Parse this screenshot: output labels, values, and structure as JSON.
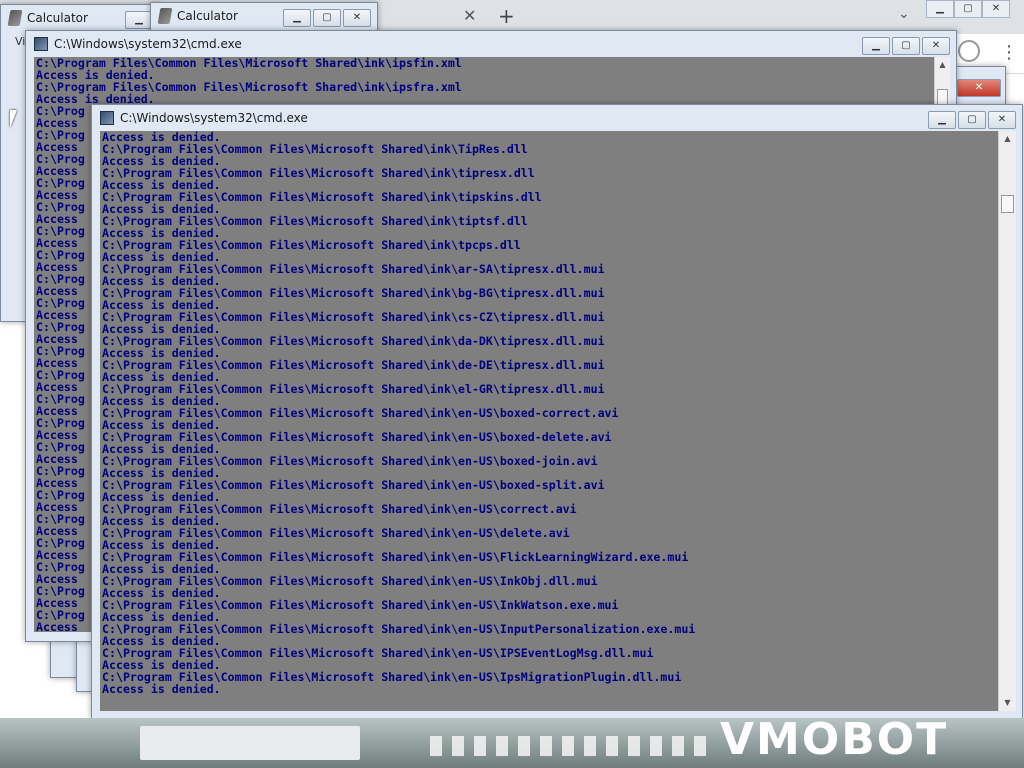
{
  "browser": {
    "close_tab_glyph": "✕",
    "new_tab_glyph": "+",
    "tab_list_glyph": "⌄",
    "menu_glyph": "⋮"
  },
  "calculator_windows": [
    {
      "title": "Calculator"
    },
    {
      "title": "Calculator"
    }
  ],
  "calc_menu_fragment": "Vi",
  "cmd_back": {
    "title": "C:\\Windows\\system32\\cmd.exe",
    "lines": "C:\\Program Files\\Common Files\\Microsoft Shared\\ink\\ipsfin.xml\nAccess is denied.\nC:\\Program Files\\Common Files\\Microsoft Shared\\ink\\ipsfra.xml\nAccess is denied.\nC:\\Prog\nAccess\nC:\\Prog\nAccess\nC:\\Prog\nAccess\nC:\\Prog\nAccess\nC:\\Prog\nAccess\nC:\\Prog\nAccess\nC:\\Prog\nAccess\nC:\\Prog\nAccess\nC:\\Prog\nAccess\nC:\\Prog\nAccess\nC:\\Prog\nAccess\nC:\\Prog\nAccess\nC:\\Prog\nAccess\nC:\\Prog\nAccess\nC:\\Prog\nAccess\nC:\\Prog\nAccess\nC:\\Prog\nAccess\nC:\\Prog\nAccess\nC:\\Prog\nAccess\nC:\\Prog\nAccess\nC:\\Prog\nAccess\nC:\\Prog\nAccess\nC:\\Prog\nAccess\nC:\\Prog\nAccess\nC:\\Prog"
  },
  "cmd_front": {
    "title": "C:\\Windows\\system32\\cmd.exe",
    "lines": "Access is denied.\nC:\\Program Files\\Common Files\\Microsoft Shared\\ink\\TipRes.dll\nAccess is denied.\nC:\\Program Files\\Common Files\\Microsoft Shared\\ink\\tipresx.dll\nAccess is denied.\nC:\\Program Files\\Common Files\\Microsoft Shared\\ink\\tipskins.dll\nAccess is denied.\nC:\\Program Files\\Common Files\\Microsoft Shared\\ink\\tiptsf.dll\nAccess is denied.\nC:\\Program Files\\Common Files\\Microsoft Shared\\ink\\tpcps.dll\nAccess is denied.\nC:\\Program Files\\Common Files\\Microsoft Shared\\ink\\ar-SA\\tipresx.dll.mui\nAccess is denied.\nC:\\Program Files\\Common Files\\Microsoft Shared\\ink\\bg-BG\\tipresx.dll.mui\nAccess is denied.\nC:\\Program Files\\Common Files\\Microsoft Shared\\ink\\cs-CZ\\tipresx.dll.mui\nAccess is denied.\nC:\\Program Files\\Common Files\\Microsoft Shared\\ink\\da-DK\\tipresx.dll.mui\nAccess is denied.\nC:\\Program Files\\Common Files\\Microsoft Shared\\ink\\de-DE\\tipresx.dll.mui\nAccess is denied.\nC:\\Program Files\\Common Files\\Microsoft Shared\\ink\\el-GR\\tipresx.dll.mui\nAccess is denied.\nC:\\Program Files\\Common Files\\Microsoft Shared\\ink\\en-US\\boxed-correct.avi\nAccess is denied.\nC:\\Program Files\\Common Files\\Microsoft Shared\\ink\\en-US\\boxed-delete.avi\nAccess is denied.\nC:\\Program Files\\Common Files\\Microsoft Shared\\ink\\en-US\\boxed-join.avi\nAccess is denied.\nC:\\Program Files\\Common Files\\Microsoft Shared\\ink\\en-US\\boxed-split.avi\nAccess is denied.\nC:\\Program Files\\Common Files\\Microsoft Shared\\ink\\en-US\\correct.avi\nAccess is denied.\nC:\\Program Files\\Common Files\\Microsoft Shared\\ink\\en-US\\delete.avi\nAccess is denied.\nC:\\Program Files\\Common Files\\Microsoft Shared\\ink\\en-US\\FlickLearningWizard.exe.mui\nAccess is denied.\nC:\\Program Files\\Common Files\\Microsoft Shared\\ink\\en-US\\InkObj.dll.mui\nAccess is denied.\nC:\\Program Files\\Common Files\\Microsoft Shared\\ink\\en-US\\InkWatson.exe.mui\nAccess is denied.\nC:\\Program Files\\Common Files\\Microsoft Shared\\ink\\en-US\\InputPersonalization.exe.mui\nAccess is denied.\nC:\\Program Files\\Common Files\\Microsoft Shared\\ink\\en-US\\IPSEventLogMsg.dll.mui\nAccess is denied.\nC:\\Program Files\\Common Files\\Microsoft Shared\\ink\\en-US\\IpsMigrationPlugin.dll.mui\nAccess is denied."
  },
  "window_controls": {
    "minimize": "▁",
    "maximize": "▢",
    "close": "✕"
  },
  "desktop_sign": "VMOBOT",
  "colors": {
    "console_bg": "#7f7f7f",
    "console_text": "#000080",
    "window_frame": "#dfe8f3"
  }
}
